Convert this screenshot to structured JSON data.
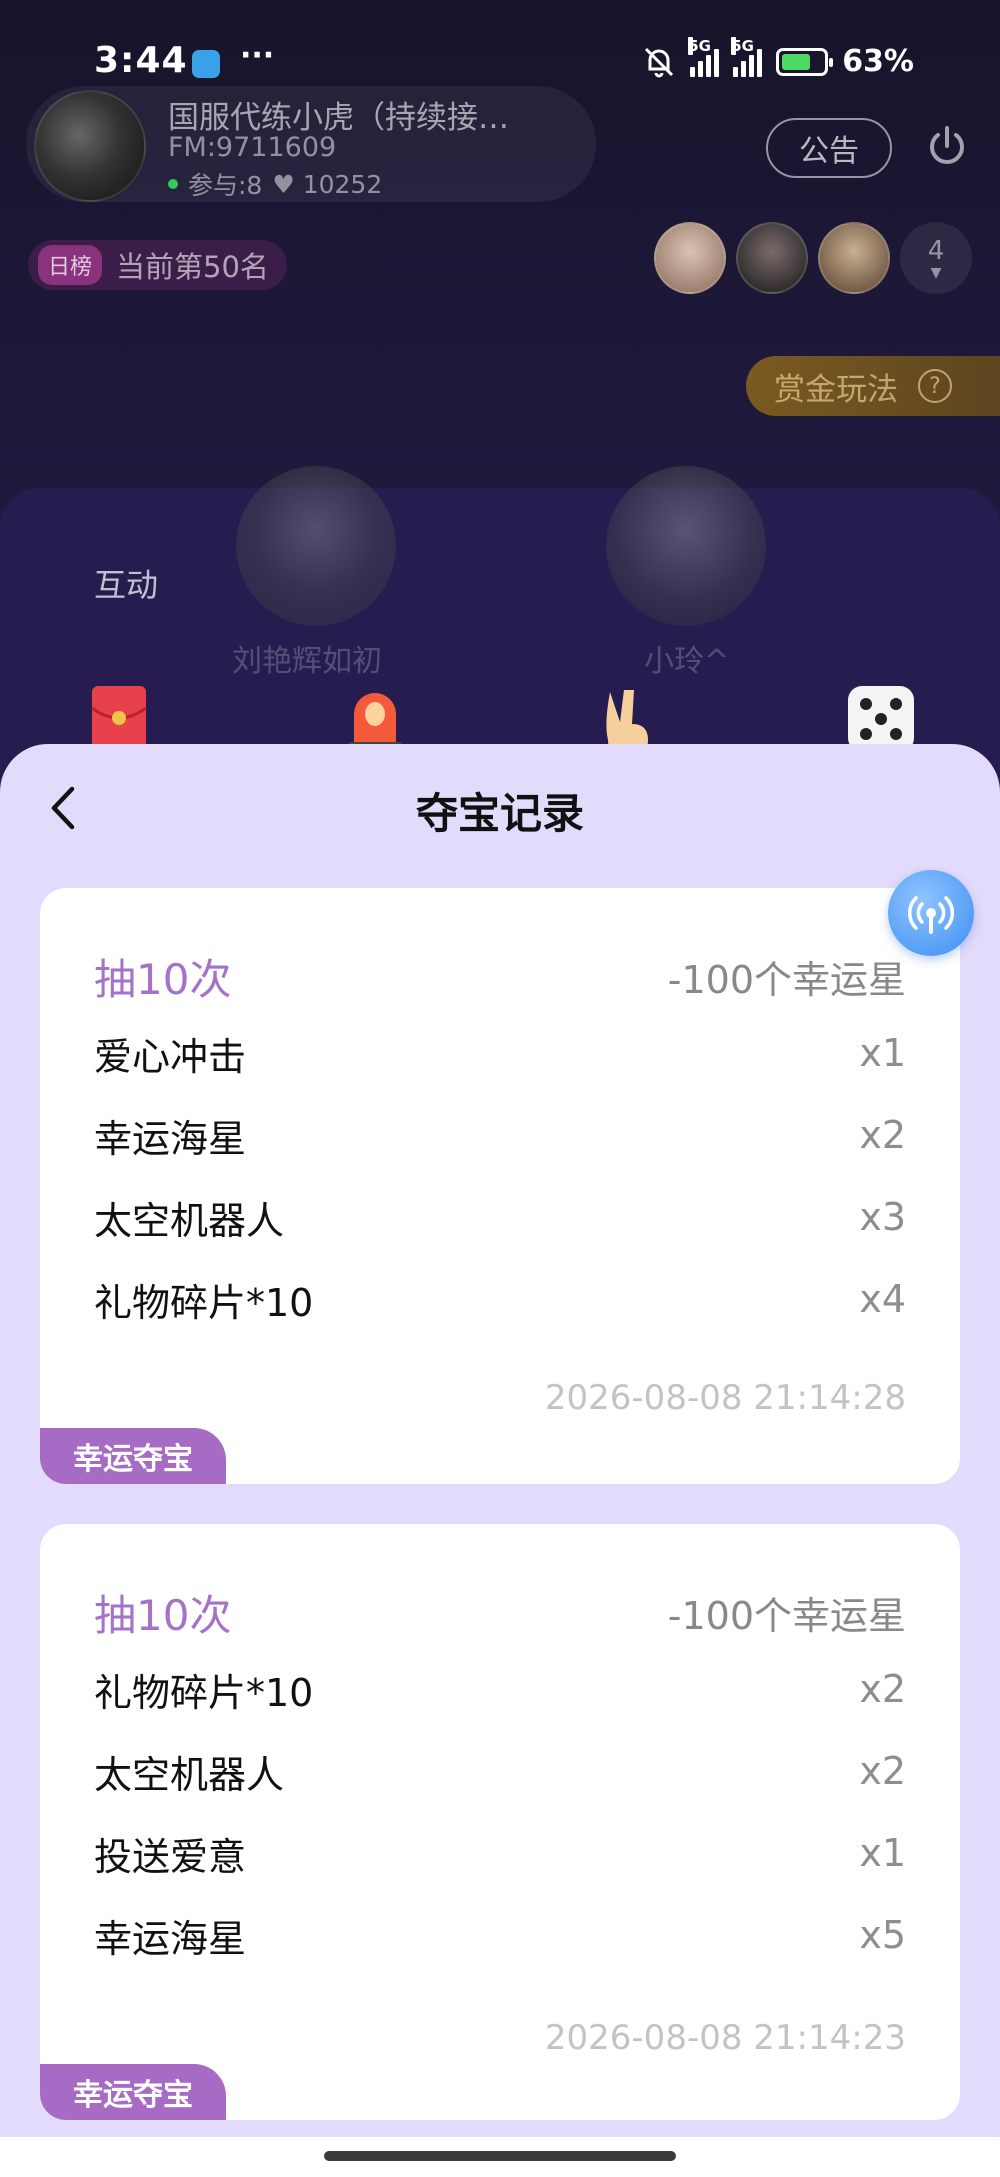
{
  "status_bar": {
    "time": "3:44",
    "dots": "···",
    "signal1": "5G",
    "signal2": "5G",
    "battery": "63%"
  },
  "room": {
    "host_name": "国服代练小虎（持续接…",
    "fm": "FM:9711609",
    "participants": "参与:8",
    "likes": "♥ 10252",
    "notice_label": "公告",
    "rank_tag": "日榜",
    "rank_text": "当前第50名",
    "viewer_count": "4",
    "bounty_label": "赏金玩法",
    "bounty_help": "?",
    "seat1_name": "刘艳辉如初",
    "seat2_name": "小玲^"
  },
  "interact": {
    "title": "互动",
    "icons": [
      "red-envelope-icon",
      "siren-icon",
      "victory-hand-icon",
      "dice-icon"
    ]
  },
  "sheet": {
    "title": "夺宝记录"
  },
  "records": [
    {
      "draw": "抽10次",
      "cost": "-100个幸运星",
      "items": [
        {
          "name": "爱心冲击",
          "qty": "x1"
        },
        {
          "name": "幸运海星",
          "qty": "x2"
        },
        {
          "name": "太空机器人",
          "qty": "x3"
        },
        {
          "name": "礼物碎片*10",
          "qty": "x4"
        }
      ],
      "timestamp": "2026-08-08 21:14:28",
      "tag": "幸运夺宝"
    },
    {
      "draw": "抽10次",
      "cost": "-100个幸运星",
      "items": [
        {
          "name": "礼物碎片*10",
          "qty": "x2"
        },
        {
          "name": "太空机器人",
          "qty": "x2"
        },
        {
          "name": "投送爱意",
          "qty": "x1"
        },
        {
          "name": "幸运海星",
          "qty": "x5"
        }
      ],
      "timestamp": "2026-08-08 21:14:23",
      "tag": "幸运夺宝"
    }
  ],
  "colors": {
    "sheet_bg": "#e3dbfb",
    "accent_purple": "#a473c8",
    "tag_purple": "#a76bc6",
    "float_blue": "#3d8ef0"
  }
}
